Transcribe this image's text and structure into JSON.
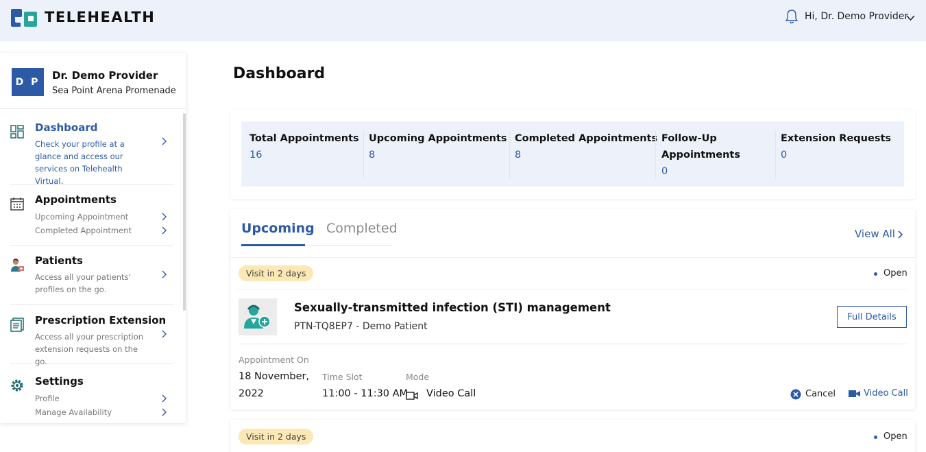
{
  "app": {
    "brand": "TELEHEALTH"
  },
  "header": {
    "greeting": "Hi, Dr. Demo  Provider"
  },
  "profile": {
    "initials": "D P",
    "name": "Dr. Demo Provider",
    "facility": "Sea Point Arena Promenade"
  },
  "sidebar": {
    "items": [
      {
        "title": "Dashboard",
        "desc": "Check your profile at a glance and access our services on Telehealth Virtual."
      },
      {
        "title": "Appointments",
        "subitems": [
          "Upcoming Appointment",
          "Completed Appointment"
        ]
      },
      {
        "title": "Patients",
        "desc": "Access all your patients' profiles on the go."
      },
      {
        "title": "Prescription Extension",
        "desc": "Access all your prescription extension requests on the go."
      },
      {
        "title": "Settings",
        "subitems": [
          "Profile",
          "Manage Availability"
        ]
      }
    ]
  },
  "main": {
    "title": "Dashboard",
    "stats": [
      {
        "label": "Total Appointments",
        "value": "16"
      },
      {
        "label": "Upcoming Appointments",
        "value": "8"
      },
      {
        "label": "Completed Appointments",
        "value": "8"
      },
      {
        "label": "Follow-Up Appointments",
        "value": "0"
      },
      {
        "label": "Extension Requests",
        "value": "0"
      }
    ],
    "tabs": [
      {
        "label": "Upcoming"
      },
      {
        "label": "Completed"
      }
    ],
    "active_tab": "Upcoming",
    "view_all": "View All",
    "appointments": [
      {
        "badge": "Visit in 2 days",
        "status": "Open",
        "title": "Sexually-transmitted infection (STI) management",
        "patient": "PTN-TQ8EP7 - Demo Patient",
        "details_label": "Full Details",
        "date_label": "Appointment On",
        "date_line1": "18 November,",
        "date_line2": "2022",
        "time_label": "Time Slot",
        "time": "11:00 - 11:30 AM",
        "mode_label": "Mode",
        "mode": "Video Call",
        "cancel_label": "Cancel",
        "call_label": "Video Call"
      },
      {
        "badge": "Visit in 2 days",
        "status": "Open"
      }
    ]
  },
  "colors": {
    "accent": "#2d5aa6",
    "teal": "#26a69a",
    "badge_bg": "#fbe8b4",
    "header_bg": "#edf2fa"
  },
  "icons": [
    "logo-icon",
    "bell-icon",
    "chevron-down-icon",
    "dashboard-icon",
    "calendar-icon",
    "patient-icon",
    "prescription-icon",
    "gear-icon",
    "chevron-right-icon",
    "doctor-icon",
    "camera-icon",
    "cancel-icon",
    "video-icon"
  ]
}
